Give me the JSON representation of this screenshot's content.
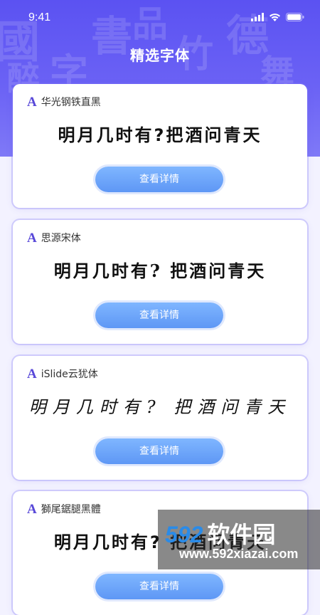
{
  "status_bar": {
    "time": "9:41"
  },
  "header": {
    "title": "精选字体",
    "decor_glyphs": [
      "國",
      "字",
      "書",
      "品",
      "竹",
      "德",
      "舞",
      "醉"
    ]
  },
  "fonts": [
    {
      "name": "华光钢铁直黑",
      "sample": "明月几时有?把酒问青天",
      "button_label": "查看详情",
      "style": "bold-heiti"
    },
    {
      "name": "思源宋体",
      "sample": "明月几时有? 把酒问青天",
      "button_label": "查看详情",
      "style": "songti"
    },
    {
      "name": "iSlide云犹体",
      "sample": "明月几时有? 把酒问青天",
      "button_label": "查看详情",
      "style": "handwritten"
    },
    {
      "name": "獅尾鋸腿黑體",
      "sample": "明月几时有? 把酒问青天",
      "button_label": "查看详情",
      "style": "heiti"
    }
  ],
  "icons": {
    "font_item": "font-a-icon",
    "signal": "signal-icon",
    "wifi": "wifi-icon",
    "battery": "battery-icon"
  },
  "watermark": {
    "number": "592",
    "brand": "软件园",
    "url": "www.592xiazai.com"
  },
  "colors": {
    "header_start": "#5b52f2",
    "header_end": "#7f79f7",
    "button": "#6ea6f8",
    "font_icon": "#5848d8",
    "watermark_number": "#2a8be8"
  }
}
